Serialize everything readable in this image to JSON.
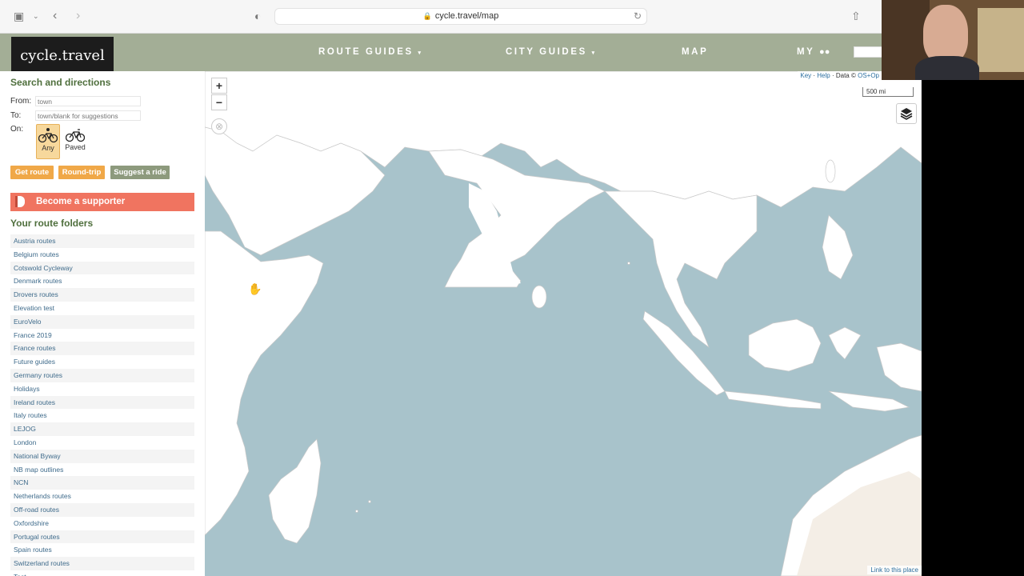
{
  "browser": {
    "url": "cycle.travel/map"
  },
  "site": {
    "logo": "cycle.travel",
    "nav": {
      "route_guides": "ROUTE GUIDES",
      "city_guides": "CITY GUIDES",
      "map": "MAP",
      "my": "MY"
    }
  },
  "sidebar": {
    "heading": "Search and directions",
    "from_label": "From:",
    "from_placeholder": "town",
    "to_label": "To:",
    "to_placeholder": "town/blank for suggestions",
    "on_label": "On:",
    "options": {
      "any": "Any",
      "paved": "Paved"
    },
    "buttons": {
      "get_route": "Get route",
      "round_trip": "Round-trip",
      "suggest": "Suggest a ride"
    },
    "supporter": "Become a supporter",
    "folders_heading": "Your route folders",
    "folders": [
      "Austria routes",
      "Belgium routes",
      "Cotswold Cycleway",
      "Denmark routes",
      "Drovers routes",
      "Elevation test",
      "EuroVelo",
      "France 2019",
      "France routes",
      "Future guides",
      "Germany routes",
      "Holidays",
      "Ireland routes",
      "Italy routes",
      "LEJOG",
      "London",
      "National Byway",
      "NB map outlines",
      "NCN",
      "Netherlands routes",
      "Off-road routes",
      "Oxfordshire",
      "Portugal routes",
      "Spain routes",
      "Switzerland routes",
      "Test"
    ]
  },
  "map": {
    "zoom_in": "+",
    "zoom_out": "−",
    "attribution": {
      "key": "Key",
      "help": "Help",
      "data": "Data ©",
      "source": "OS+Op"
    },
    "scale": "500 mi",
    "link_to_place": "Link to this place"
  },
  "colors": {
    "header_bg": "#a3ae96",
    "accent_green": "#4f6f3d",
    "orange_button": "#f0a848",
    "supporter_red": "#f07460",
    "sea": "#a8c3cb",
    "land": "#ffffff"
  }
}
